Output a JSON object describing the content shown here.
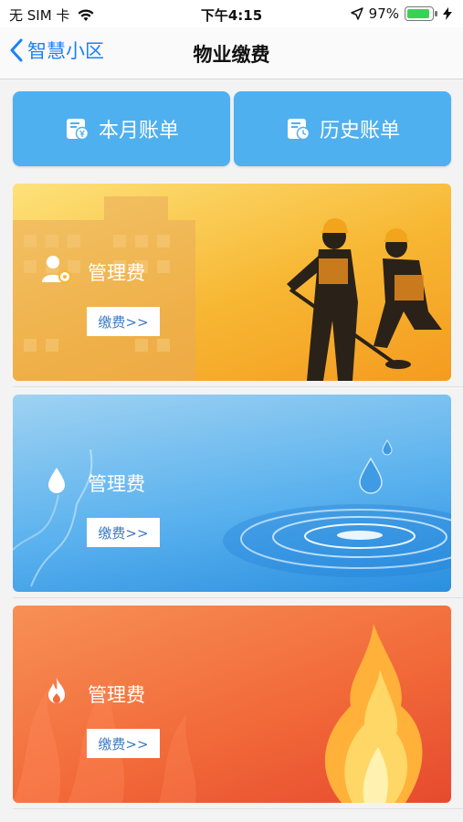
{
  "status_bar": {
    "carrier": "无 SIM 卡",
    "time": "下午4:15",
    "battery_percent": "97%",
    "battery_level": 0.97,
    "icons": [
      "wifi-icon",
      "location-arrow-icon",
      "battery-icon",
      "charging-bolt-icon"
    ]
  },
  "nav": {
    "back_label": "智慧小区",
    "title": "物业缴费"
  },
  "tabs": [
    {
      "label": "本月账单",
      "icon": "bill-yen-icon"
    },
    {
      "label": "历史账单",
      "icon": "history-bill-icon"
    }
  ],
  "cards": [
    {
      "label": "管理费",
      "button": "缴费>>",
      "icon": "property-staff-icon",
      "theme": "#f7b733"
    },
    {
      "label": "管理费",
      "button": "缴费>>",
      "icon": "water-drop-icon",
      "theme": "#5bb2ee"
    },
    {
      "label": "管理费",
      "button": "缴费>>",
      "icon": "flame-icon",
      "theme": "#f26b3a"
    }
  ],
  "colors": {
    "accent": "#1a82f7",
    "tab_bg": "#4fb0ef",
    "pay_text": "#3b7ac4"
  }
}
